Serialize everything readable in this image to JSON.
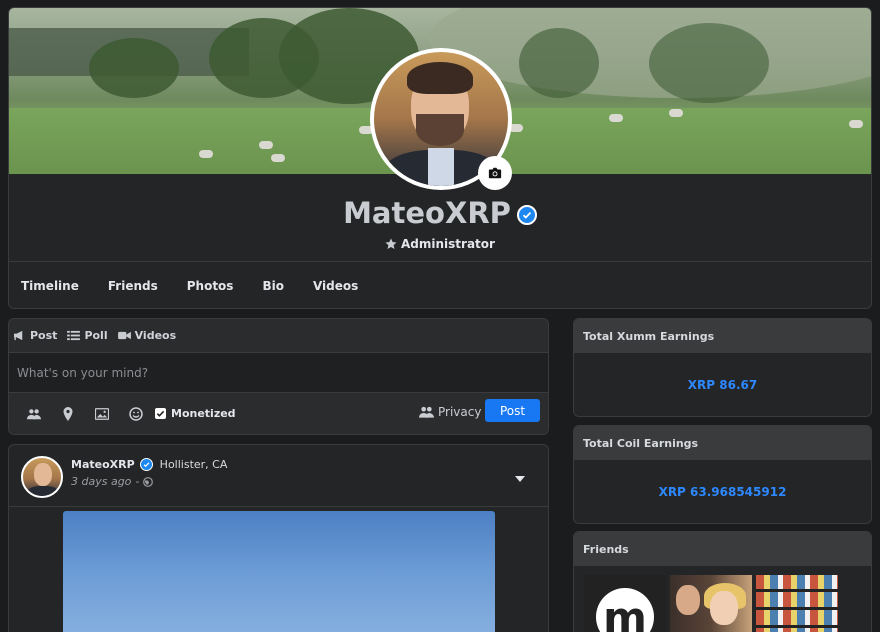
{
  "profile": {
    "name": "MateoXRP",
    "role": "Administrator",
    "tabs": [
      "Timeline",
      "Friends",
      "Photos",
      "Bio",
      "Videos"
    ]
  },
  "composer": {
    "tabs": {
      "post": "Post",
      "poll": "Poll",
      "videos": "Videos"
    },
    "placeholder": "What's on your mind?",
    "monetized_label": "Monetized",
    "monetized_checked": true,
    "privacy_label": "Privacy",
    "post_button": "Post"
  },
  "post": {
    "author": "MateoXRP",
    "location": "Hollister, CA",
    "time": "3 days ago",
    "time_separator": "-"
  },
  "sidebar": {
    "xumm": {
      "title": "Total Xumm Earnings",
      "value": "XRP 86.67"
    },
    "coil": {
      "title": "Total Coil Earnings",
      "value": "XRP 63.968545912"
    },
    "friends": {
      "title": "Friends"
    }
  },
  "colors": {
    "accent": "#1877f2",
    "earnings": "#2d88ff",
    "background": "#1b1c1d",
    "card": "#242526"
  }
}
